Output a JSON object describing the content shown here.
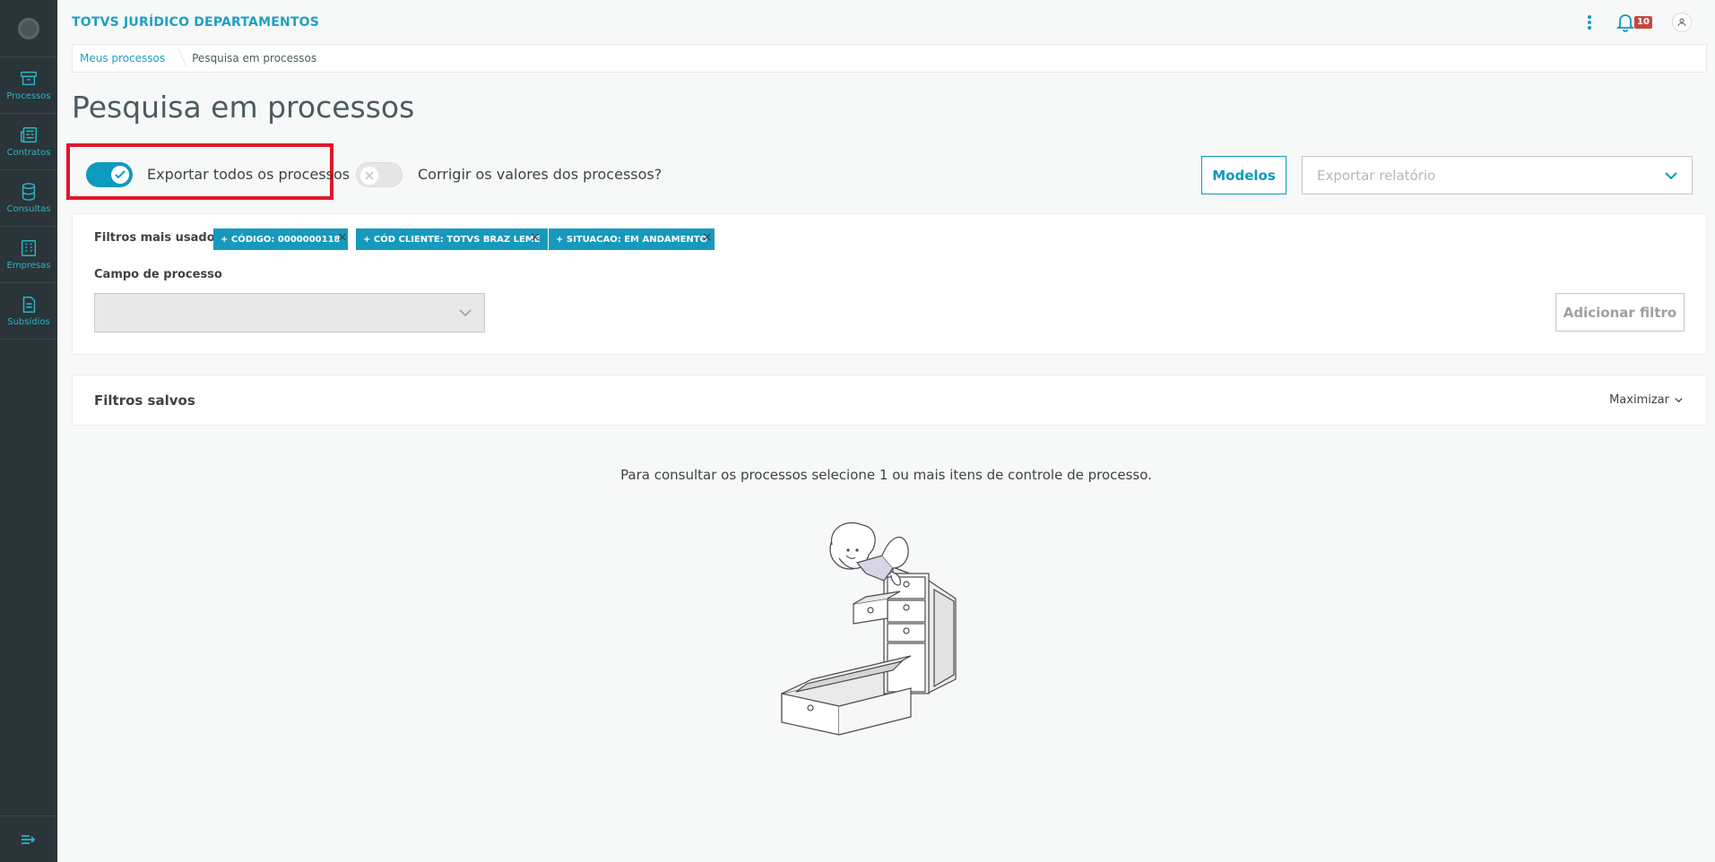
{
  "app": {
    "title": "TOTVS JURÍDICO DEPARTAMENTOS"
  },
  "sidebar": {
    "items": [
      {
        "label": "Processos",
        "icon": "archive-box-icon"
      },
      {
        "label": "Contratos",
        "icon": "newspaper-icon"
      },
      {
        "label": "Consultas",
        "icon": "database-icon"
      },
      {
        "label": "Empresas",
        "icon": "building-icon"
      },
      {
        "label": "Subsídios",
        "icon": "document-icon"
      }
    ]
  },
  "header": {
    "notification_count": "10"
  },
  "breadcrumb": {
    "link": "Meus processos",
    "current": "Pesquisa em processos"
  },
  "page": {
    "title": "Pesquisa em processos"
  },
  "toggles": {
    "export_all": {
      "label": "Exportar todos os processos",
      "on": true
    },
    "correct_values": {
      "label": "Corrigir os valores dos processos?",
      "on": false
    }
  },
  "actions": {
    "modelos_label": "Modelos",
    "export_placeholder": "Exportar relatório"
  },
  "filters": {
    "most_used_label": "Filtros mais usados",
    "chips": [
      "+ CÓDIGO: 0000000118",
      "+ CÓD CLIENTE: TOTVS BRAZ LEME",
      "+ SITUACAO: EM ANDAMENTO"
    ],
    "chip_remove": "×",
    "field_label": "Campo de processo",
    "add_label": "Adicionar filtro"
  },
  "saved_filters": {
    "title": "Filtros salvos",
    "toggle_label": "Maximizar"
  },
  "empty": {
    "message": "Para consultar os processos selecione 1 ou mais itens de controle de processo."
  },
  "colors": {
    "accent": "#0c9abe",
    "sidebar": "#2a3439",
    "highlight": "#e0162b",
    "badge": "#c64840"
  }
}
